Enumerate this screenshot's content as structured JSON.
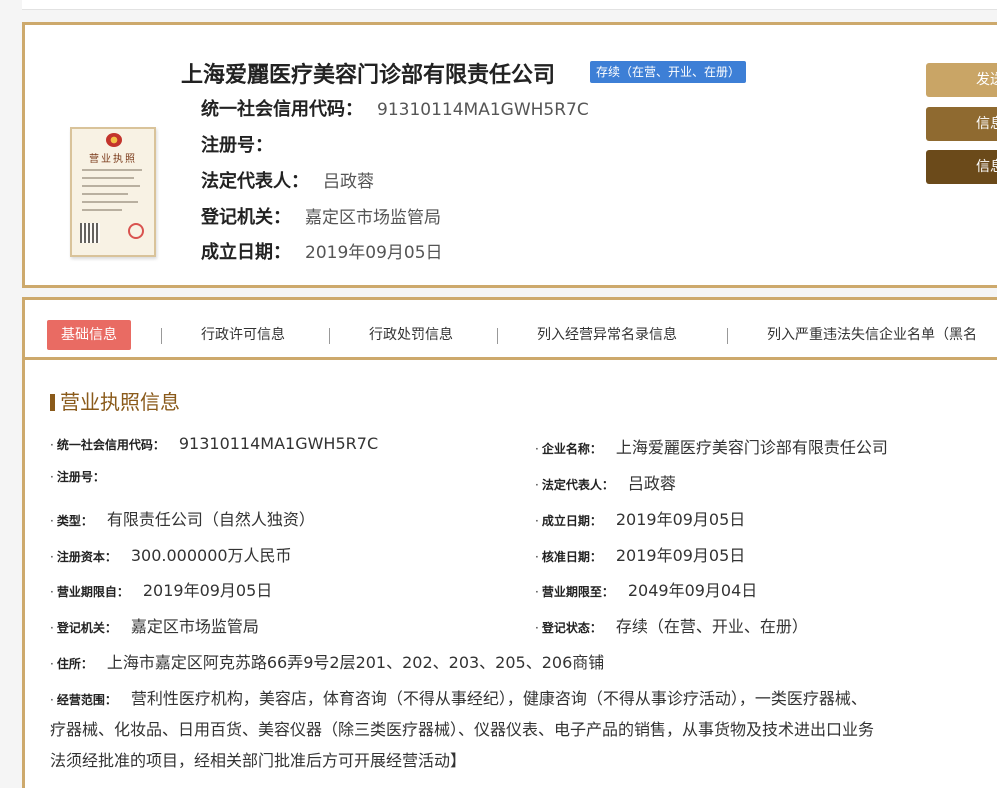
{
  "company": {
    "name": "上海爱麗医疗美容门诊部有限责任公司",
    "status_tag": "存续（在营、开业、在册）",
    "credit_code_label": "统一社会信用代码：",
    "credit_code": "91310114MA1GWH5R7C",
    "reg_no_label": "注册号：",
    "reg_no": "",
    "legal_rep_label": "法定代表人：",
    "legal_rep": "吕政蓉",
    "reg_authority_label": "登记机关：",
    "reg_authority": "嘉定区市场监管局",
    "est_date_label": "成立日期：",
    "est_date": "2019年09月05日",
    "license_title": "营业执照"
  },
  "side_buttons": [
    "发送",
    "信息",
    "信息"
  ],
  "tabs": [
    {
      "label": "基础信息",
      "active": true
    },
    {
      "label": "行政许可信息",
      "active": false
    },
    {
      "label": "行政处罚信息",
      "active": false
    },
    {
      "label": "列入经营异常名录信息",
      "active": false
    },
    {
      "label": "列入严重违法失信企业名单（黑名",
      "active": false
    }
  ],
  "section_title": "营业执照信息",
  "fields": {
    "credit_code": {
      "label": "统一社会信用代码：",
      "value": "91310114MA1GWH5R7C"
    },
    "company_name": {
      "label": "企业名称：",
      "value": "上海爱麗医疗美容门诊部有限责任公司"
    },
    "reg_no": {
      "label": "注册号：",
      "value": ""
    },
    "legal_rep": {
      "label": "法定代表人：",
      "value": "吕政蓉"
    },
    "type": {
      "label": "类型：",
      "value": "有限责任公司（自然人独资）"
    },
    "est_date": {
      "label": "成立日期：",
      "value": "2019年09月05日"
    },
    "reg_capital": {
      "label": "注册资本：",
      "value": "300.000000万人民币"
    },
    "approve_date": {
      "label": "核准日期：",
      "value": "2019年09月05日"
    },
    "period_from": {
      "label": "营业期限自：",
      "value": "2019年09月05日"
    },
    "period_to": {
      "label": "营业期限至：",
      "value": "2049年09月04日"
    },
    "reg_authority": {
      "label": "登记机关：",
      "value": "嘉定区市场监管局"
    },
    "reg_status": {
      "label": "登记状态：",
      "value": "存续（在营、开业、在册）"
    },
    "address": {
      "label": "住所：",
      "value": "上海市嘉定区阿克苏路66弄9号2层201、202、203、205、206商铺"
    },
    "scope": {
      "label": "经营范围：",
      "line1": "营利性医疗机构，美容店，体育咨询（不得从事经纪），健康咨询（不得从事诊疗活动），一类医疗器械、",
      "line2": "疗器械、化妆品、日用百货、美容仪器（除三类医疗器械）、仪器仪表、电子产品的销售，从事货物及技术进出口业务",
      "line3": "法须经批准的项目，经相关部门批准后方可开展经营活动】"
    }
  },
  "colors": {
    "gold_border": "#cda96c",
    "tag_blue": "#3d7fd6",
    "active_tab": "#e96b63",
    "section_brown": "#8a5a1a"
  }
}
